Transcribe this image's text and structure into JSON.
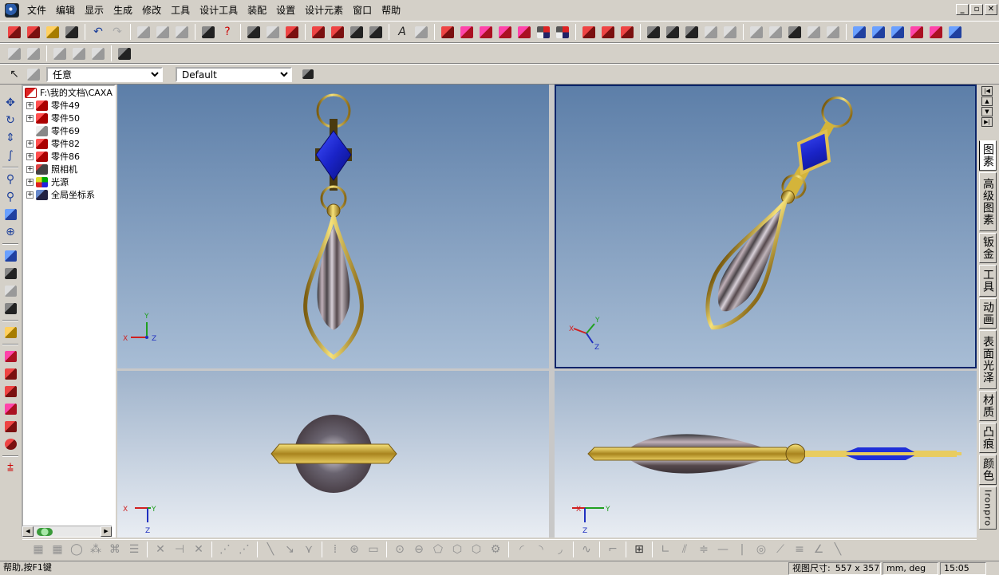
{
  "menu": [
    "文件",
    "编辑",
    "显示",
    "生成",
    "修改",
    "工具",
    "设计工具",
    "装配",
    "设置",
    "设计元素",
    "窗口",
    "帮助"
  ],
  "window_controls": [
    "_",
    "▫",
    "✕"
  ],
  "selection_filter": {
    "value": "任意",
    "options": [
      "任意"
    ]
  },
  "config_combo": {
    "value": "Default",
    "options": [
      "Default"
    ]
  },
  "tree": {
    "root": "F:\\我的文档\\CAXA",
    "items": [
      {
        "label": "零件49",
        "expander": "+",
        "icon": "part-red-icon"
      },
      {
        "label": "零件50",
        "expander": "+",
        "icon": "part-red-icon"
      },
      {
        "label": "零件69",
        "expander": "",
        "icon": "part-grey-icon"
      },
      {
        "label": "零件82",
        "expander": "+",
        "icon": "part-red-icon"
      },
      {
        "label": "零件86",
        "expander": "+",
        "icon": "part-red-icon"
      },
      {
        "label": "照相机",
        "expander": "+",
        "icon": "camera-icon"
      },
      {
        "label": "光源",
        "expander": "+",
        "icon": "light-icon"
      },
      {
        "label": "全局坐标系",
        "expander": "+",
        "icon": "axis-icon"
      }
    ]
  },
  "right_tabs": [
    "图素",
    "高级图素",
    "钣金",
    "工具",
    "动画",
    "表面光泽",
    "材质",
    "凸痕",
    "颜色",
    "Ironpro"
  ],
  "viewports": {
    "top_left": {
      "axes": [
        "X",
        "Y",
        "Z"
      ]
    },
    "top_right": {
      "axes": [
        "X",
        "Y",
        "Z"
      ]
    },
    "bottom_left": {
      "axes": [
        "X",
        "Y",
        "Z"
      ]
    },
    "bottom_right": {
      "axes": [
        "X",
        "Y",
        "Z"
      ]
    }
  },
  "status": {
    "help": "帮助,按F1键",
    "view_size_label": "视图尺寸:",
    "view_size": "557 x 357",
    "units": "mm, deg",
    "time": "15:05"
  },
  "colors": {
    "accent": "#0a246a",
    "gold": "#d4b43a",
    "gem": "#1f2fd8"
  }
}
